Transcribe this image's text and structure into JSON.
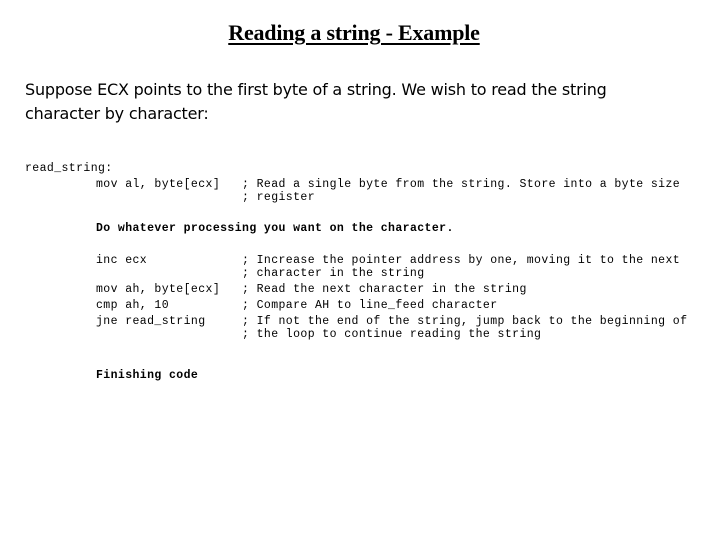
{
  "title": "Reading a string - Example",
  "intro": {
    "line1": "Suppose ECX points to the first byte of a string. We wish to read the string",
    "line2": "character by character:"
  },
  "code": {
    "label": "read_string:",
    "block1": {
      "instructions": [
        "mov al, byte[ecx]",
        ""
      ],
      "comments": [
        "; Read a single byte from the string. Store into a byte size",
        "; register"
      ]
    },
    "processing_note": "Do whatever processing you want on the character.",
    "block2": {
      "rows": [
        {
          "instruction": "inc ecx",
          "comment": "; Increase the pointer address by one, moving it to the next"
        },
        {
          "instruction": "",
          "comment": "; character in the string"
        },
        {
          "instruction": "mov ah, byte[ecx]",
          "comment": "; Read the next character in the string"
        },
        {
          "instruction": "cmp ah, 10",
          "comment": "; Compare AH to line_feed character"
        },
        {
          "instruction": "jne read_string",
          "comment": "; If not the end of the string, jump back to the beginning of"
        },
        {
          "instruction": "",
          "comment": "; the loop to continue reading the string"
        }
      ]
    },
    "finishing_note": "Finishing code"
  }
}
